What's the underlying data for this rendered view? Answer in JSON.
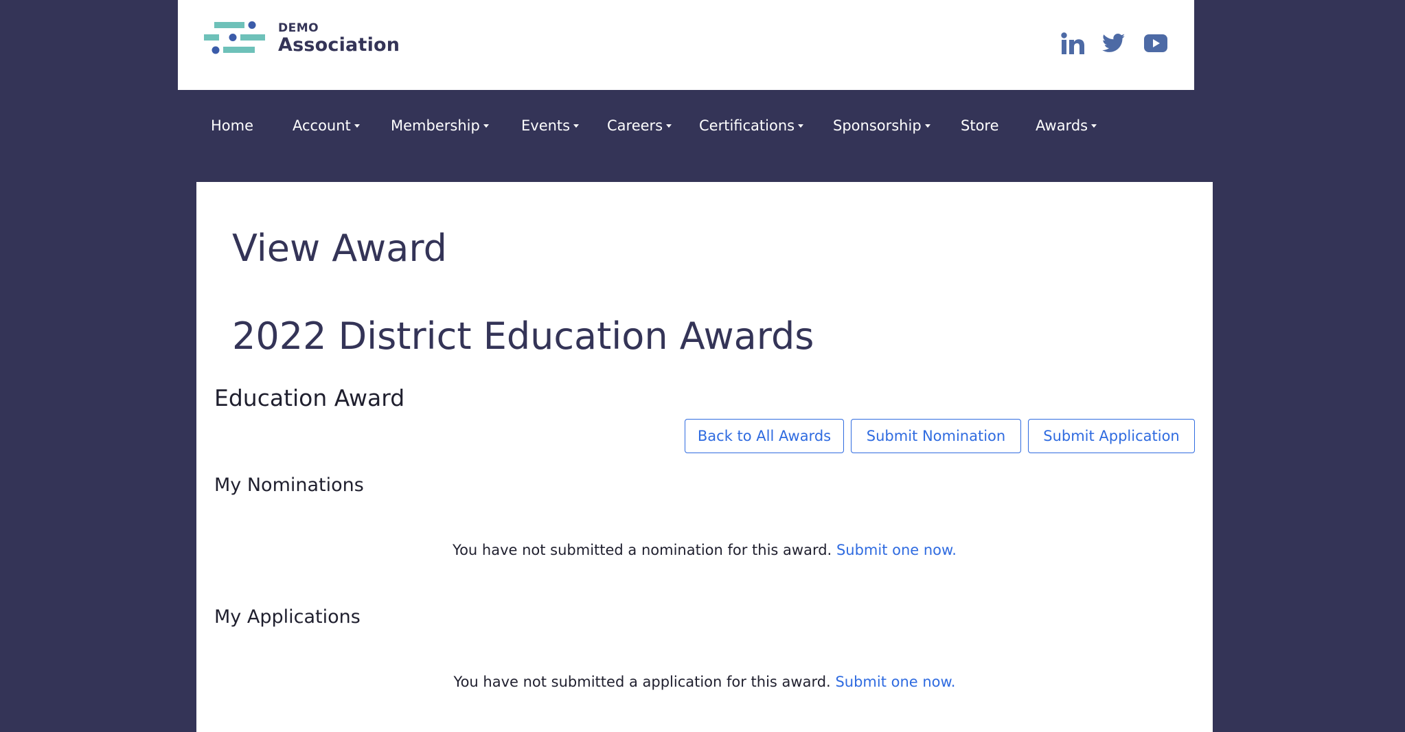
{
  "header": {
    "brand_small": "DEMO",
    "brand_big": "Association",
    "social": [
      {
        "name": "linkedin-icon"
      },
      {
        "name": "twitter-icon"
      },
      {
        "name": "youtube-icon"
      }
    ]
  },
  "nav": {
    "items": [
      {
        "label": "Home",
        "has_dropdown": false
      },
      {
        "label": "Account",
        "has_dropdown": true
      },
      {
        "label": "Membership",
        "has_dropdown": true
      },
      {
        "label": "Events",
        "has_dropdown": true
      },
      {
        "label": "Careers",
        "has_dropdown": true
      },
      {
        "label": "Certifications",
        "has_dropdown": true
      },
      {
        "label": "Sponsorship",
        "has_dropdown": true
      },
      {
        "label": "Store",
        "has_dropdown": false
      },
      {
        "label": "Awards",
        "has_dropdown": true
      }
    ]
  },
  "main": {
    "page_title": "View Award",
    "award_title": "2022 District Education Awards",
    "award_subtitle": "Education Award",
    "buttons": {
      "back": "Back to All Awards",
      "nominate": "Submit Nomination",
      "apply": "Submit Application"
    },
    "nominations": {
      "title": "My Nominations",
      "empty_text": "You have not submitted a nomination for this award.",
      "link_text": "Submit one now."
    },
    "applications": {
      "title": "My Applications",
      "empty_text": "You have not submitted a application for this award.",
      "link_text": "Submit one now."
    }
  },
  "colors": {
    "background": "#343457",
    "brand_navy": "#343457",
    "logo_teal": "#6ec1b9",
    "logo_blue": "#3b5ba9",
    "social_blue": "#4d6aa5",
    "link_blue": "#2f6be0"
  }
}
